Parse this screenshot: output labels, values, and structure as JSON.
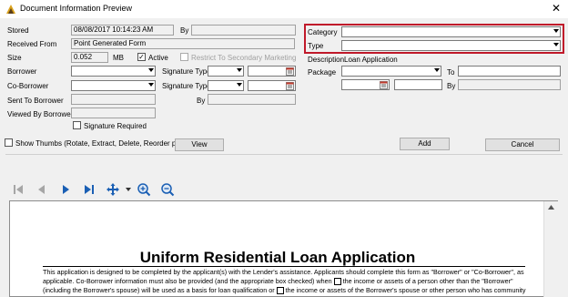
{
  "window": {
    "title": "Document Information Preview"
  },
  "form": {
    "stored_label": "Stored",
    "stored_value": "08/08/2017   10:14:23 AM",
    "by_label": "By",
    "received_from_label": "Received From",
    "received_from_value": "Point Generated Form",
    "size_label": "Size",
    "size_value": "0.052",
    "size_unit": "MB",
    "active_label": "Active",
    "active_checked": "✓",
    "restrict_label": "Restrict To Secondary Marketing",
    "borrower_label": "Borrower",
    "coborrower_label": "Co-Borrower",
    "sent_to_borrower_label": "Sent To Borrower",
    "viewed_by_borrower_label": "Viewed By Borrower",
    "signature_required_label": "Signature Required",
    "signature_type_label_1": "Signature Type",
    "signature_type_label_2": "Signature Type",
    "sig_by_label": "By",
    "category_label": "Category",
    "type_label": "Type",
    "description_label": "Description",
    "description_value": "Loan Application",
    "package_label": "Package",
    "to_label": "To",
    "by2_label": "By"
  },
  "actions": {
    "show_thumbs_label": "Show Thumbs (Rotate, Extract, Delete, Reorder pages)",
    "view_label": "View",
    "add_label": "Add",
    "cancel_label": "Cancel"
  },
  "toolbar": {
    "icons": [
      "first-page-icon",
      "prev-page-icon",
      "next-page-icon",
      "last-page-icon",
      "pan-move-icon",
      "zoom-in-icon",
      "zoom-out-icon"
    ]
  },
  "document": {
    "title": "Uniform Residential Loan Application",
    "line1": "This application is designed to be completed by the applicant(s) with the Lender's assistance. Applicants should complete this form as \"Borrower\" or \"Co-Borrower\", as",
    "line2_a": "applicable. Co-Borrower information must also be provided (and the appropriate box checked) when",
    "line2_b": "the income or assets of a person other than the \"Borrower\"",
    "line3_a": "(including the Borrower's spouse) will be used as a basis for loan qualification or",
    "line3_b": "the income or assets of the Borrower's spouse or other person who has community"
  },
  "colors": {
    "highlight_border": "#c0192a",
    "nav_blue": "#1a5fb4"
  }
}
